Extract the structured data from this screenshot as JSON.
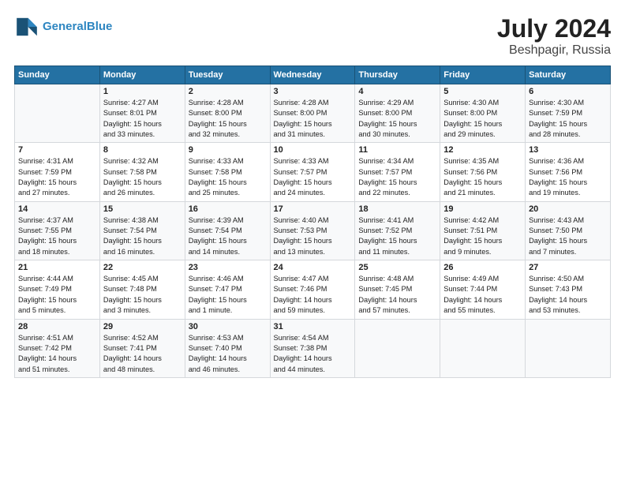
{
  "header": {
    "logo_line1": "General",
    "logo_line2": "Blue",
    "month": "July 2024",
    "location": "Beshpagir, Russia"
  },
  "columns": [
    "Sunday",
    "Monday",
    "Tuesday",
    "Wednesday",
    "Thursday",
    "Friday",
    "Saturday"
  ],
  "weeks": [
    [
      {
        "day": "",
        "content": ""
      },
      {
        "day": "1",
        "content": "Sunrise: 4:27 AM\nSunset: 8:01 PM\nDaylight: 15 hours\nand 33 minutes."
      },
      {
        "day": "2",
        "content": "Sunrise: 4:28 AM\nSunset: 8:00 PM\nDaylight: 15 hours\nand 32 minutes."
      },
      {
        "day": "3",
        "content": "Sunrise: 4:28 AM\nSunset: 8:00 PM\nDaylight: 15 hours\nand 31 minutes."
      },
      {
        "day": "4",
        "content": "Sunrise: 4:29 AM\nSunset: 8:00 PM\nDaylight: 15 hours\nand 30 minutes."
      },
      {
        "day": "5",
        "content": "Sunrise: 4:30 AM\nSunset: 8:00 PM\nDaylight: 15 hours\nand 29 minutes."
      },
      {
        "day": "6",
        "content": "Sunrise: 4:30 AM\nSunset: 7:59 PM\nDaylight: 15 hours\nand 28 minutes."
      }
    ],
    [
      {
        "day": "7",
        "content": "Sunrise: 4:31 AM\nSunset: 7:59 PM\nDaylight: 15 hours\nand 27 minutes."
      },
      {
        "day": "8",
        "content": "Sunrise: 4:32 AM\nSunset: 7:58 PM\nDaylight: 15 hours\nand 26 minutes."
      },
      {
        "day": "9",
        "content": "Sunrise: 4:33 AM\nSunset: 7:58 PM\nDaylight: 15 hours\nand 25 minutes."
      },
      {
        "day": "10",
        "content": "Sunrise: 4:33 AM\nSunset: 7:57 PM\nDaylight: 15 hours\nand 24 minutes."
      },
      {
        "day": "11",
        "content": "Sunrise: 4:34 AM\nSunset: 7:57 PM\nDaylight: 15 hours\nand 22 minutes."
      },
      {
        "day": "12",
        "content": "Sunrise: 4:35 AM\nSunset: 7:56 PM\nDaylight: 15 hours\nand 21 minutes."
      },
      {
        "day": "13",
        "content": "Sunrise: 4:36 AM\nSunset: 7:56 PM\nDaylight: 15 hours\nand 19 minutes."
      }
    ],
    [
      {
        "day": "14",
        "content": "Sunrise: 4:37 AM\nSunset: 7:55 PM\nDaylight: 15 hours\nand 18 minutes."
      },
      {
        "day": "15",
        "content": "Sunrise: 4:38 AM\nSunset: 7:54 PM\nDaylight: 15 hours\nand 16 minutes."
      },
      {
        "day": "16",
        "content": "Sunrise: 4:39 AM\nSunset: 7:54 PM\nDaylight: 15 hours\nand 14 minutes."
      },
      {
        "day": "17",
        "content": "Sunrise: 4:40 AM\nSunset: 7:53 PM\nDaylight: 15 hours\nand 13 minutes."
      },
      {
        "day": "18",
        "content": "Sunrise: 4:41 AM\nSunset: 7:52 PM\nDaylight: 15 hours\nand 11 minutes."
      },
      {
        "day": "19",
        "content": "Sunrise: 4:42 AM\nSunset: 7:51 PM\nDaylight: 15 hours\nand 9 minutes."
      },
      {
        "day": "20",
        "content": "Sunrise: 4:43 AM\nSunset: 7:50 PM\nDaylight: 15 hours\nand 7 minutes."
      }
    ],
    [
      {
        "day": "21",
        "content": "Sunrise: 4:44 AM\nSunset: 7:49 PM\nDaylight: 15 hours\nand 5 minutes."
      },
      {
        "day": "22",
        "content": "Sunrise: 4:45 AM\nSunset: 7:48 PM\nDaylight: 15 hours\nand 3 minutes."
      },
      {
        "day": "23",
        "content": "Sunrise: 4:46 AM\nSunset: 7:47 PM\nDaylight: 15 hours\nand 1 minute."
      },
      {
        "day": "24",
        "content": "Sunrise: 4:47 AM\nSunset: 7:46 PM\nDaylight: 14 hours\nand 59 minutes."
      },
      {
        "day": "25",
        "content": "Sunrise: 4:48 AM\nSunset: 7:45 PM\nDaylight: 14 hours\nand 57 minutes."
      },
      {
        "day": "26",
        "content": "Sunrise: 4:49 AM\nSunset: 7:44 PM\nDaylight: 14 hours\nand 55 minutes."
      },
      {
        "day": "27",
        "content": "Sunrise: 4:50 AM\nSunset: 7:43 PM\nDaylight: 14 hours\nand 53 minutes."
      }
    ],
    [
      {
        "day": "28",
        "content": "Sunrise: 4:51 AM\nSunset: 7:42 PM\nDaylight: 14 hours\nand 51 minutes."
      },
      {
        "day": "29",
        "content": "Sunrise: 4:52 AM\nSunset: 7:41 PM\nDaylight: 14 hours\nand 48 minutes."
      },
      {
        "day": "30",
        "content": "Sunrise: 4:53 AM\nSunset: 7:40 PM\nDaylight: 14 hours\nand 46 minutes."
      },
      {
        "day": "31",
        "content": "Sunrise: 4:54 AM\nSunset: 7:38 PM\nDaylight: 14 hours\nand 44 minutes."
      },
      {
        "day": "",
        "content": ""
      },
      {
        "day": "",
        "content": ""
      },
      {
        "day": "",
        "content": ""
      }
    ]
  ]
}
